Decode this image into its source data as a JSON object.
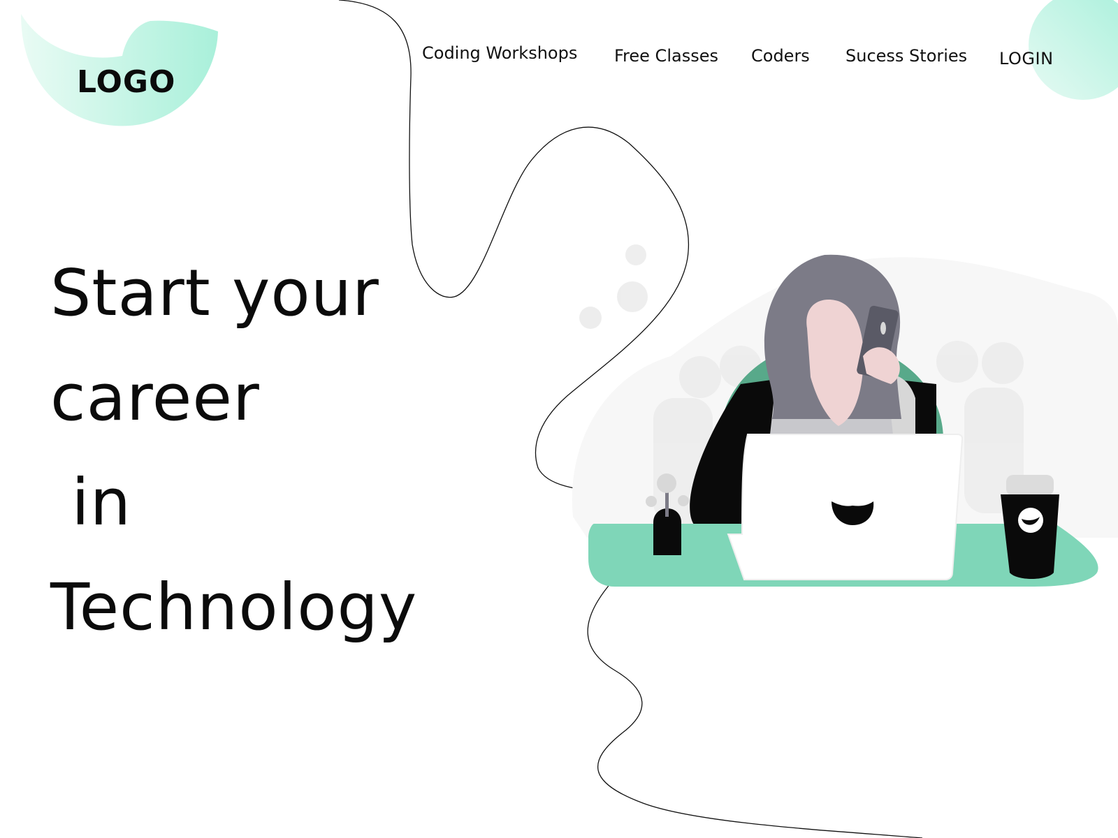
{
  "brand": {
    "logo_text": "LOGO",
    "accent_color": "#a8f0db",
    "accent_light": "#e6faf3"
  },
  "nav": {
    "items": [
      {
        "label": "Coding Workshops"
      },
      {
        "label": "Free Classes"
      },
      {
        "label": "Coders"
      },
      {
        "label": "Sucess Stories"
      }
    ],
    "login_label": "LOGIN"
  },
  "hero": {
    "line1": "Start your",
    "line2": "career",
    "line3": " in",
    "line4": "Technology"
  },
  "illustration": {
    "desk_color": "#7fd6b8",
    "hair_color": "#7c7b87",
    "skin_color": "#efd3d3",
    "chair_color": "#58a98a"
  }
}
